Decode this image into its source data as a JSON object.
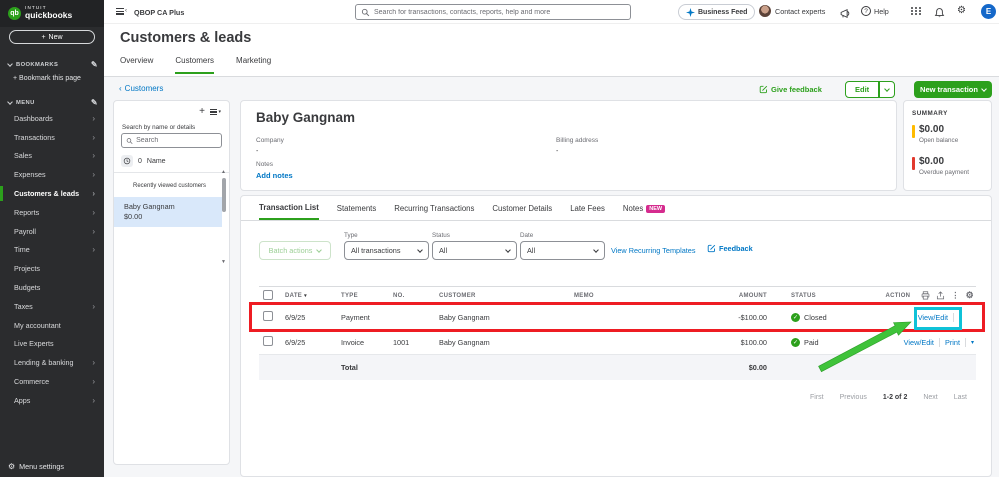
{
  "topbar": {
    "brand_intuit": "INTUIT",
    "brand_product": "quickbooks",
    "qb_monogram": "qb",
    "company": "QBOP CA Plus",
    "search_placeholder": "Search for transactions, contacts, reports, help and more",
    "business_feed": "Business Feed",
    "contact_experts": "Contact experts",
    "help": "Help",
    "avatar_initial": "E",
    "avatar_color": "#1568c9"
  },
  "sidebar": {
    "new_button": "New",
    "bookmarks_label": "BOOKMARKS",
    "bookmark_this_page": "+  Bookmark this page",
    "menu_label": "MENU",
    "items": [
      {
        "label": "Dashboards"
      },
      {
        "label": "Transactions"
      },
      {
        "label": "Sales"
      },
      {
        "label": "Expenses"
      },
      {
        "label": "Customers & leads"
      },
      {
        "label": "Reports"
      },
      {
        "label": "Payroll"
      },
      {
        "label": "Time"
      },
      {
        "label": "Projects"
      },
      {
        "label": "Budgets"
      },
      {
        "label": "Taxes"
      },
      {
        "label": "My accountant"
      },
      {
        "label": "Live Experts"
      },
      {
        "label": "Lending & banking"
      },
      {
        "label": "Commerce"
      },
      {
        "label": "Apps"
      }
    ],
    "active_item": "Customers & leads",
    "menu_settings": "Menu settings"
  },
  "page": {
    "title": "Customers & leads",
    "tabs": [
      "Overview",
      "Customers",
      "Marketing"
    ],
    "active_tab": "Customers",
    "back_link": "Customers"
  },
  "customer_list": {
    "search_label": "Search by name or details",
    "search_placeholder": "Search",
    "count": "0",
    "sort_label": "Name",
    "section": "Recently viewed customers",
    "items": [
      {
        "name": "Baby Gangnam",
        "balance": "$0.00"
      }
    ]
  },
  "customer": {
    "name": "Baby Gangnam",
    "company_label": "Company",
    "company_value": "-",
    "billing_label": "Billing address",
    "billing_value": "-",
    "notes_label": "Notes",
    "add_notes": "Add notes"
  },
  "actions": {
    "give_feedback": "Give feedback",
    "edit": "Edit",
    "new_transaction": "New transaction"
  },
  "summary": {
    "title": "SUMMARY",
    "open": {
      "amount": "$0.00",
      "label": "Open balance",
      "color": "#ffbb00"
    },
    "overdue": {
      "amount": "$0.00",
      "label": "Overdue payment",
      "color": "#e23a2e"
    }
  },
  "detail_tabs": {
    "items": [
      "Transaction List",
      "Statements",
      "Recurring Transactions",
      "Customer Details",
      "Late Fees",
      "Notes"
    ],
    "active": "Transaction List",
    "new_badge": "NEW"
  },
  "filters": {
    "batch_actions": "Batch actions",
    "type_label": "Type",
    "type_value": "All transactions",
    "status_label": "Status",
    "status_value": "All",
    "date_label": "Date",
    "date_value": "All",
    "view_recurring": "View Recurring Templates",
    "feedback": "Feedback"
  },
  "table": {
    "columns": [
      "DATE",
      "TYPE",
      "NO.",
      "CUSTOMER",
      "MEMO",
      "AMOUNT",
      "STATUS",
      "ACTION"
    ],
    "rows": [
      {
        "date": "6/9/25",
        "type": "Payment",
        "no": "",
        "customer": "Baby Gangnam",
        "memo": "",
        "amount": "-$100.00",
        "status": "Closed",
        "actions": [
          "View/Edit"
        ]
      },
      {
        "date": "6/9/25",
        "type": "Invoice",
        "no": "1001",
        "customer": "Baby Gangnam",
        "memo": "",
        "amount": "$100.00",
        "status": "Paid",
        "actions": [
          "View/Edit",
          "Print"
        ]
      }
    ],
    "total_label": "Total",
    "total_value": "$0.00"
  },
  "pagination": {
    "first": "First",
    "previous": "Previous",
    "range": "1-2 of 2",
    "next": "Next",
    "last": "Last"
  },
  "annotations": {
    "highlight_box_color": "#ee1c23",
    "target_box_color": "#0fc2d8",
    "arrow_color": "#3fc33a"
  }
}
